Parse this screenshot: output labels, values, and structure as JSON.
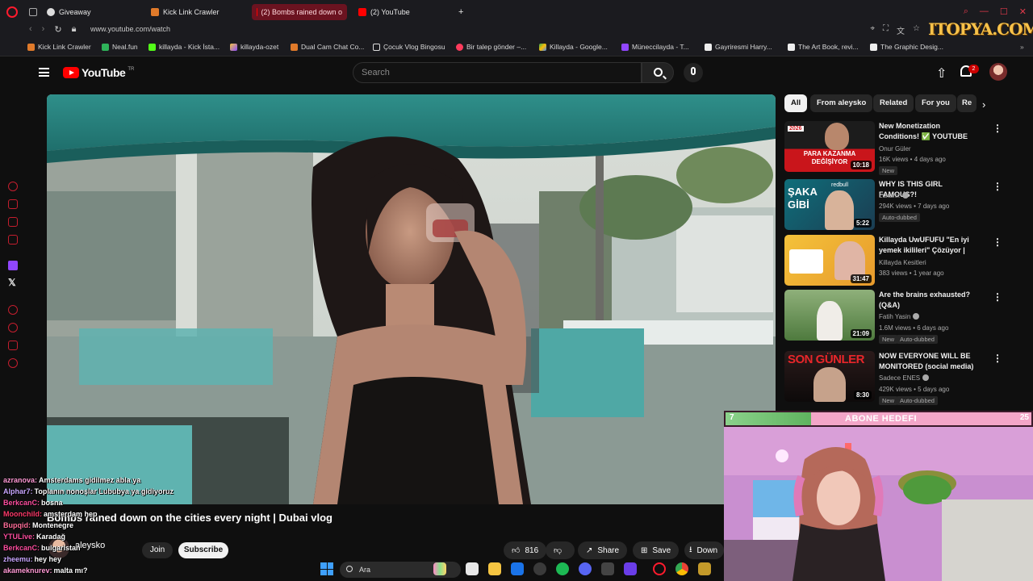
{
  "browser": {
    "tabs": [
      {
        "label": "Giveaway"
      },
      {
        "label": "Kick Link Crawler"
      },
      {
        "label": "(2) Bombs rained down o"
      },
      {
        "label": "(2) YouTube"
      }
    ],
    "new_tab": "+",
    "url": "www.youtube.com/watch",
    "bookmarks": [
      {
        "label": "Kick Link Crawler"
      },
      {
        "label": "Neal.fun"
      },
      {
        "label": "killayda - Kick İsta..."
      },
      {
        "label": "killayda-ozet"
      },
      {
        "label": "Dual Cam Chat Co..."
      },
      {
        "label": "Çocuk Vlog Bingosu"
      },
      {
        "label": "Bir talep gönder –..."
      },
      {
        "label": "Killayda - Google..."
      },
      {
        "label": "Müneccilayda - T..."
      },
      {
        "label": "Gayriresmi Harry..."
      },
      {
        "label": "The Art Book, revi..."
      },
      {
        "label": "The Graphic Desig..."
      }
    ],
    "watermark": "ITOPYA.COM"
  },
  "youtube": {
    "logo_text": "YouTube",
    "logo_sup": "TR",
    "search_placeholder": "Search",
    "notifications": "2",
    "video": {
      "title": "Bombs rained down on the cities every night | Dubai vlog",
      "channel": "aleysko",
      "join": "Join",
      "subscribe": "Subscribe",
      "likes": "816",
      "share": "Share",
      "save": "Save",
      "download": "Down"
    },
    "chips": [
      "All",
      "From aleysko",
      "Related",
      "For you",
      "Re"
    ],
    "recommendations": [
      {
        "title": "New Monetization Conditions! ✅ YOUTUBE SHOWS NO ...",
        "channel": "Onur Güler",
        "stats": "16K views • 4 days ago",
        "badge": "New",
        "duration": "10:18",
        "thumb_text": "PARA KAZANMA DEĞİŞİYOR",
        "thumb_tag": "2026"
      },
      {
        "title": "WHY IS THIS GIRL FAMOUS?!",
        "channel": "Lukarix",
        "stats": "294K views • 7 days ago",
        "badge": "Auto-dubbed",
        "duration": "5:22",
        "thumb_text": "ŞAKA GİBİ",
        "thumb_tag": "redbull"
      },
      {
        "title": "Killayda UwUFUFU \"En iyi yemek ikilileri\" Çözüyor | Olaylı ve ...",
        "channel": "Killayda Kesitleri",
        "stats": "383 views • 1 year ago",
        "badge": "",
        "duration": "31:47",
        "thumb_text": "",
        "thumb_tag": ""
      },
      {
        "title": "Are the brains exhausted? (Q&A)",
        "channel": "Fatih Yasin",
        "stats": "1.6M views • 6 days ago",
        "badge": "New",
        "badge2": "Auto-dubbed",
        "duration": "21:09",
        "thumb_text": "",
        "thumb_tag": ""
      },
      {
        "title": "NOW EVERYONE WILL BE MONITORED (social media)",
        "channel": "Sadece ENES",
        "stats": "429K views • 5 days ago",
        "badge": "New",
        "badge2": "Auto-dubbed",
        "duration": "8:30",
        "thumb_text": "SON GÜNLER",
        "thumb_tag": ""
      }
    ]
  },
  "stream_overlay": {
    "goal_label": "ABONE HEDEFI",
    "goal_start": "7",
    "goal_end": "25",
    "goal_progress": 0.28,
    "chat": [
      {
        "user": "azranova:",
        "message": "Amsterdams gidilmez abla ya",
        "color": "#ff9ad5"
      },
      {
        "user": "Alphar7:",
        "message": "Toplanın nonoşlar Lububya ya gidiyoruz",
        "color": "#c9a7ff"
      },
      {
        "user": "BerkcanC:",
        "message": "bosna",
        "color": "#ff4fa0"
      },
      {
        "user": "Moonchild:",
        "message": "amsterdam hep",
        "color": "#ff3b6b"
      },
      {
        "user": "Bupqid:",
        "message": "Montenegre",
        "color": "#ff6f9a"
      },
      {
        "user": "YTULive:",
        "message": "Karadağ",
        "color": "#ff4fa0"
      },
      {
        "user": "BerkcanC:",
        "message": "bulgaristan",
        "color": "#ff4fa0"
      },
      {
        "user": "zheemu:",
        "message": "hey hey",
        "color": "#c9a7ff"
      },
      {
        "user": "akameknurev:",
        "message": "malta mı?",
        "color": "#ff9ad5"
      }
    ]
  },
  "taskbar": {
    "search_label": "Ara"
  },
  "colors": {
    "accent_red": "#ff0000",
    "opera_red": "#ff1b2d",
    "chip_active": "#f1f1f1",
    "goal_pink": "#f3a6c8",
    "goal_green": "#6cc46c"
  }
}
